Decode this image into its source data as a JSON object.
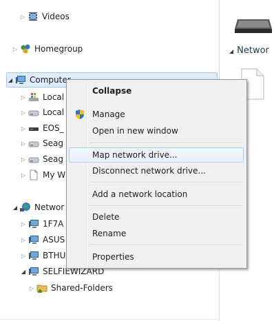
{
  "nav": {
    "videos": "Videos",
    "homegroup": "Homegroup",
    "computer": "Computer",
    "computer_children": [
      "Local",
      "Local",
      "EOS_",
      "Seag",
      "Seag",
      "My W"
    ],
    "network": "Networ",
    "network_children": [
      "1F7A",
      "ASUS",
      "BTHU"
    ],
    "selfiewizard": "SELFIEWIZARD",
    "shared_folders": "Shared-Folders"
  },
  "content": {
    "network_header": "Networ"
  },
  "context_menu": {
    "collapse": "Collapse",
    "manage": "Manage",
    "open_new_window": "Open in new window",
    "map_network_drive": "Map network drive...",
    "disconnect_network_drive": "Disconnect network drive...",
    "add_network_location": "Add a network location",
    "delete": "Delete",
    "rename": "Rename",
    "properties": "Properties"
  },
  "colors": {
    "selection_bg": "#ddecfc",
    "hover_border": "#a8cbf1",
    "menu_bg": "#f0f0f0"
  }
}
